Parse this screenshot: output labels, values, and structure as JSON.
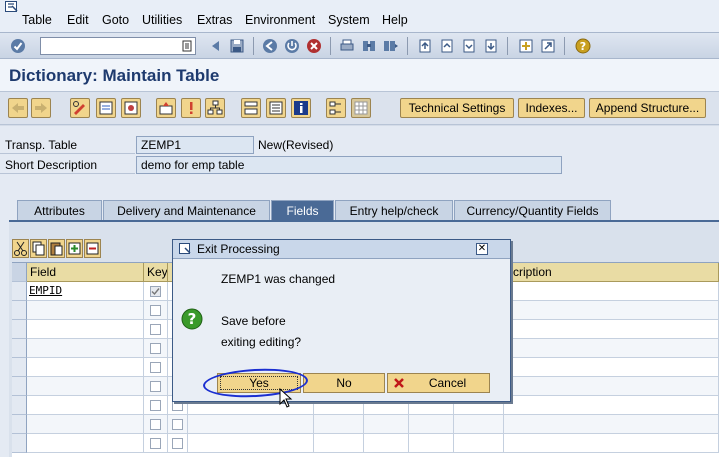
{
  "menu": {
    "items": [
      "Table",
      "Edit",
      "Goto",
      "Utilities",
      "Extras",
      "Environment",
      "System",
      "Help"
    ]
  },
  "command_field": {
    "value": ""
  },
  "title": "Dictionary: Maintain Table",
  "app_toolbar": {
    "technical_settings": "Technical Settings",
    "indexes": "Indexes...",
    "append_structure": "Append Structure..."
  },
  "form": {
    "transp_table_label": "Transp. Table",
    "transp_table_value": "ZEMP1",
    "status": "New(Revised)",
    "short_desc_label": "Short Description",
    "short_desc_value": "demo for emp table"
  },
  "tabs": [
    {
      "label": "Attributes",
      "active": false
    },
    {
      "label": "Delivery and Maintenance",
      "active": false
    },
    {
      "label": "Fields",
      "active": true
    },
    {
      "label": "Entry help/check",
      "active": false
    },
    {
      "label": "Currency/Quantity Fields",
      "active": false
    }
  ],
  "grid": {
    "col_field": "Field",
    "col_key": "Key",
    "col_desc_partial": "scription",
    "rows": [
      {
        "field": "EMPID"
      }
    ]
  },
  "dialog": {
    "title": "Exit Processing",
    "message": "ZEMP1 was changed",
    "question_line1": "Save before",
    "question_line2": "exiting editing?",
    "yes": "Yes",
    "no": "No",
    "cancel": "Cancel",
    "close_glyph": "✕"
  },
  "colors": {
    "title_blue": "#1e3a6e",
    "button_gold": "#f1d58c",
    "active_tab": "#4a6a96",
    "annotation_blue": "#1a2ed0"
  }
}
